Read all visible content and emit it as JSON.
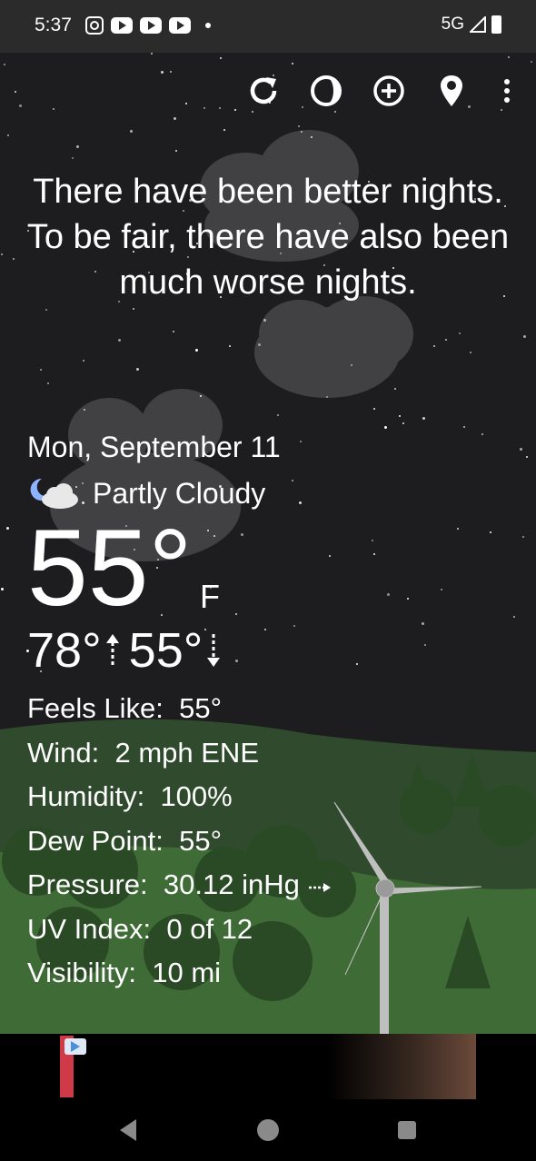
{
  "status_bar": {
    "time": "5:37",
    "network": "5G",
    "icons": [
      "instagram-icon",
      "youtube-icon",
      "youtube-icon",
      "youtube-icon",
      "notification-dot-icon",
      "signal-icon",
      "battery-icon"
    ]
  },
  "toolbar": {
    "buttons": [
      "refresh-icon",
      "moon-phase-icon",
      "add-location-icon",
      "location-pin-icon",
      "more-vert-icon"
    ]
  },
  "quote": "There have been better nights. To be fair, there have also been much worse nights.",
  "weather": {
    "date": "Mon, September 11",
    "condition": "Partly Cloudy",
    "temperature": "55°",
    "unit": "F",
    "high": "78°",
    "low": "55°",
    "details": [
      {
        "label": "Feels Like:",
        "value": "55°"
      },
      {
        "label": "Wind:",
        "value": "2 mph ENE"
      },
      {
        "label": "Humidity:",
        "value": "100%"
      },
      {
        "label": "Dew Point:",
        "value": "55°"
      },
      {
        "label": "Pressure:",
        "value": "30.12 inHg"
      },
      {
        "label": "UV Index:",
        "value": "0 of 12"
      },
      {
        "label": "Visibility:",
        "value": "10 mi"
      }
    ]
  },
  "colors": {
    "sky": "#1d1d1f",
    "hills": "#3a5a33",
    "status_bar": "#2b2b2b",
    "ad_accent": "#d03a48"
  }
}
